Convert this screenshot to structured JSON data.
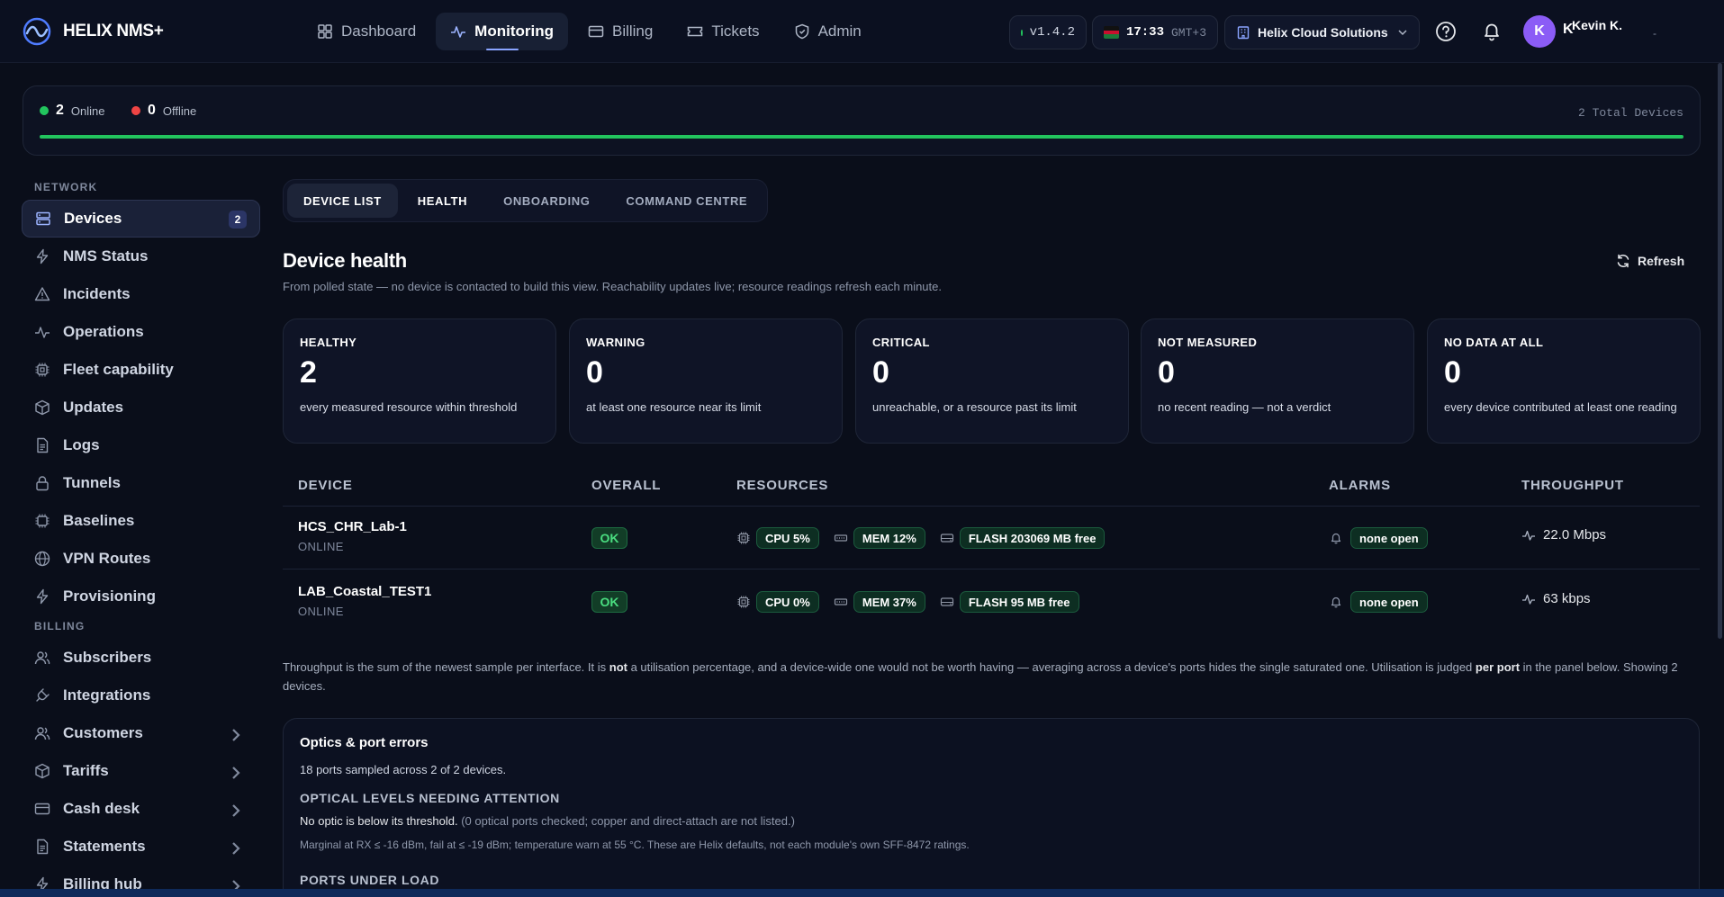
{
  "app": {
    "brand": "HELIX NMS+"
  },
  "nav": [
    {
      "label": "Dashboard",
      "icon": "dashboard-icon"
    },
    {
      "label": "Monitoring",
      "icon": "activity-icon",
      "active": true
    },
    {
      "label": "Billing",
      "icon": "card-icon"
    },
    {
      "label": "Tickets",
      "icon": "ticket-icon"
    },
    {
      "label": "Admin",
      "icon": "shield-icon"
    }
  ],
  "header": {
    "version": "v1.4.2",
    "time": "17:33",
    "timezone": "GMT+3",
    "tenant": "Helix Cloud Solutions",
    "avatar_letter": "K",
    "user_initial": "K",
    "user_name": "Kevin K.",
    "user_dash": "-"
  },
  "status": {
    "online_count": "2",
    "online_label": "Online",
    "offline_count": "0",
    "offline_label": "Offline",
    "total": "2 Total Devices",
    "online_fraction": 1.0,
    "online_color": "#22c55e",
    "offline_color": "#ef4444"
  },
  "sidebar": {
    "network_heading": "NETWORK",
    "billing_heading": "BILLING",
    "network_items": [
      {
        "label": "Devices",
        "badge": "2",
        "active": true
      },
      {
        "label": "NMS Status"
      },
      {
        "label": "Incidents"
      },
      {
        "label": "Operations"
      },
      {
        "label": "Fleet capability"
      },
      {
        "label": "Updates"
      },
      {
        "label": "Logs"
      },
      {
        "label": "Tunnels"
      },
      {
        "label": "Baselines"
      },
      {
        "label": "VPN Routes"
      },
      {
        "label": "Provisioning"
      }
    ],
    "billing_items": [
      {
        "label": "Subscribers"
      },
      {
        "label": "Integrations"
      },
      {
        "label": "Customers",
        "chevron": true
      },
      {
        "label": "Tariffs",
        "chevron": true
      },
      {
        "label": "Cash desk",
        "chevron": true
      },
      {
        "label": "Statements",
        "chevron": true
      },
      {
        "label": "Billing hub",
        "chevron": true
      }
    ]
  },
  "tabs": [
    {
      "label": "DEVICE LIST",
      "active": true
    },
    {
      "label": "HEALTH"
    },
    {
      "label": "ONBOARDING"
    },
    {
      "label": "COMMAND CENTRE"
    }
  ],
  "page": {
    "title": "Device health",
    "subtitle": "From polled state — no device is contacted to build this view. Reachability updates live; resource readings refresh each minute.",
    "refresh_label": "Refresh"
  },
  "cards": [
    {
      "title": "HEALTHY",
      "value": "2",
      "desc": "every measured resource within threshold"
    },
    {
      "title": "WARNING",
      "value": "0",
      "desc": "at least one resource near its limit"
    },
    {
      "title": "CRITICAL",
      "value": "0",
      "desc": "unreachable, or a resource past its limit"
    },
    {
      "title": "NOT MEASURED",
      "value": "0",
      "desc": "no recent reading — not a verdict"
    },
    {
      "title": "NO DATA AT ALL",
      "value": "0",
      "desc": "every device contributed at least one reading"
    }
  ],
  "table": {
    "headers": {
      "device": "DEVICE",
      "overall": "OVERALL",
      "resources": "RESOURCES",
      "alarms": "ALARMS",
      "throughput": "THROUGHPUT"
    },
    "rows": [
      {
        "name": "HCS_CHR_Lab-1",
        "status": "ONLINE",
        "overall": "OK",
        "cpu": "CPU 5%",
        "mem": "MEM 12%",
        "flash": "FLASH 203069 MB free",
        "alarms": "none open",
        "throughput": "22.0 Mbps"
      },
      {
        "name": "LAB_Coastal_TEST1",
        "status": "ONLINE",
        "overall": "OK",
        "cpu": "CPU 0%",
        "mem": "MEM 37%",
        "flash": "FLASH 95 MB free",
        "alarms": "none open",
        "throughput": "63 kbps"
      }
    ]
  },
  "note": {
    "part1": "Throughput is the sum of the newest sample per interface. It is ",
    "bold1": "not",
    "part2": " a utilisation percentage, and a device-wide one would not be worth having — averaging across a device's ports hides the single saturated one. Utilisation is judged ",
    "bold2": "per port",
    "part3": " in the panel below. Showing 2 devices."
  },
  "optics": {
    "title": "Optics & port errors",
    "subtitle": "18 ports sampled across 2 of 2 devices.",
    "levels_heading": "OPTICAL LEVELS NEEDING ATTENTION",
    "levels_line": "No optic is below its threshold.",
    "levels_muted": " (0 optical ports checked; copper and direct-attach are not listed.)",
    "foot": "Marginal at RX ≤ -16 dBm, fail at ≤ -19 dBm; temperature warn at 55 °C. These are Helix defaults, not each module's own SFF-8472 ratings.",
    "ports_heading": "PORTS UNDER LOAD"
  }
}
